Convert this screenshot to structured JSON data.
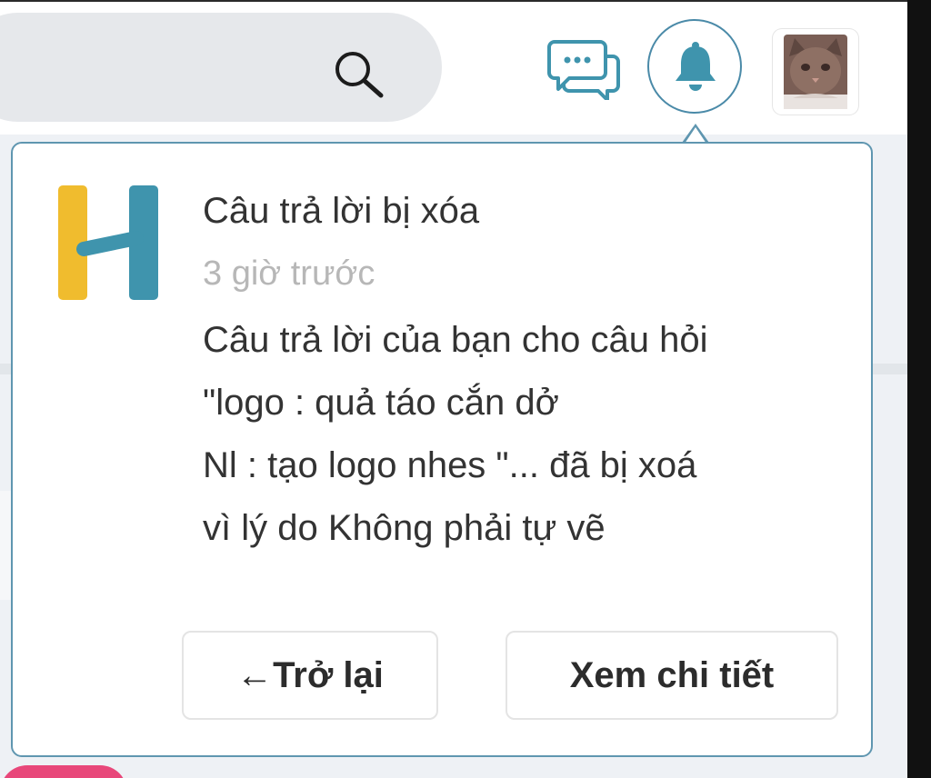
{
  "header": {
    "search": {
      "value": "",
      "placeholder": "",
      "icon": "search-icon"
    },
    "messages_icon": "chat-icon",
    "notifications_icon": "bell-icon",
    "avatar_icon": "cat-avatar"
  },
  "notification": {
    "logo_icon": "hoc24-logo",
    "title": "Câu trả lời bị xóa",
    "time": "3 giờ trước",
    "body_lines": [
      "Câu trả lời của bạn cho câu hỏi",
      "\"logo : quả táo cắn dở",
      "Nl : tạo logo nhes \"... đã bị xoá",
      "vì lý do Không phải tự vẽ"
    ],
    "back_label": "←Trở lại",
    "detail_label": "Xem chi tiết"
  },
  "colors": {
    "accent": "#4a8aa8",
    "popup_border": "#5f96b0",
    "logo_yellow": "#f0bc2e",
    "logo_teal": "#3f94ad",
    "muted_text": "#b7b7b7"
  }
}
